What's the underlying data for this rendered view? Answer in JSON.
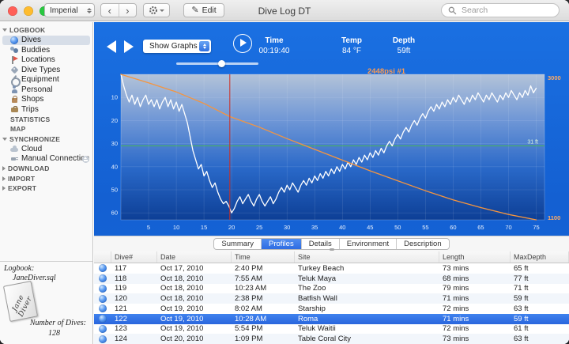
{
  "window": {
    "title": "Dive Log DT"
  },
  "toolbar": {
    "units_selector": "Imperial",
    "edit_label": "Edit",
    "search_placeholder": "Search"
  },
  "icons": {
    "back_chevron": "‹",
    "forward_chevron": "›",
    "pencil": "✎"
  },
  "sidebar": {
    "sections": [
      {
        "label": "LOGBOOK",
        "disclosure": "expanded",
        "items": [
          {
            "label": "Dives",
            "icon": "dive",
            "selected": true
          },
          {
            "label": "Buddies",
            "icon": "buddies"
          },
          {
            "label": "Locations",
            "icon": "location"
          },
          {
            "label": "Dive Types",
            "icon": "divetype"
          },
          {
            "label": "Equipment",
            "icon": "equipment"
          },
          {
            "label": "Personal",
            "icon": "personal"
          },
          {
            "label": "Shops",
            "icon": "shop"
          },
          {
            "label": "Trips",
            "icon": "trip"
          }
        ]
      },
      {
        "label": "STATISTICS",
        "disclosure": "none",
        "items": []
      },
      {
        "label": "MAP",
        "disclosure": "none",
        "items": []
      },
      {
        "label": "SYNCHRONIZE",
        "disclosure": "expanded",
        "items": [
          {
            "label": "Cloud",
            "icon": "cloud"
          },
          {
            "label": "Manual Connection",
            "icon": "connection",
            "trailing_icon": "eject"
          }
        ]
      },
      {
        "label": "DOWNLOAD",
        "disclosure": "collapsed",
        "items": []
      },
      {
        "label": "IMPORT",
        "disclosure": "collapsed",
        "items": []
      },
      {
        "label": "EXPORT",
        "disclosure": "collapsed",
        "items": []
      }
    ],
    "footer": {
      "logbook_label": "Logbook:",
      "logbook_name": "JaneDiver.sql",
      "book_text": "Jane Diver",
      "dive_count_label": "Number of Dives:",
      "dive_count": "128"
    }
  },
  "player": {
    "graph_mode": "Show Graphs",
    "time_label": "Time",
    "time_value": "00:19:40",
    "temp_label": "Temp",
    "temp_value": "84 °F",
    "depth_label": "Depth",
    "depth_value": "59ft",
    "pressure_readout": "2448psi #1",
    "slider_position": 0.55
  },
  "tabs": [
    "Summary",
    "Profiles",
    "Details",
    "Environment",
    "Description"
  ],
  "active_tab": "Profiles",
  "chart_data": {
    "type": "line",
    "x_unit": "min",
    "x_max": 76.5,
    "x_ticks": [
      5,
      10,
      15,
      20,
      25,
      30,
      35,
      40,
      45,
      50,
      55,
      60,
      65,
      70,
      75
    ],
    "depth_axis": {
      "unit": "ft",
      "max": 63,
      "ticks": [
        10,
        20,
        30,
        40,
        50,
        60
      ]
    },
    "pressure_axis": {
      "unit": "psi",
      "top": 3000,
      "bottom": 1100
    },
    "average_depth": {
      "value": 31,
      "label": "31 ft",
      "color": "#46b653"
    },
    "cursor": {
      "time_min": 19.67,
      "color": "#cf2e22"
    },
    "series": [
      {
        "name": "depth",
        "axis": "depth",
        "color": "#ffffff",
        "width": 1.3,
        "points": [
          [
            0,
            0
          ],
          [
            0.5,
            5
          ],
          [
            1,
            9
          ],
          [
            1.5,
            12
          ],
          [
            2,
            9
          ],
          [
            2.5,
            13
          ],
          [
            3,
            10
          ],
          [
            3.5,
            14
          ],
          [
            4,
            11
          ],
          [
            4.5,
            9
          ],
          [
            5,
            13
          ],
          [
            5.5,
            11
          ],
          [
            6,
            14
          ],
          [
            6.5,
            11
          ],
          [
            7,
            15
          ],
          [
            7.5,
            12
          ],
          [
            8,
            10
          ],
          [
            8.5,
            14
          ],
          [
            9,
            11
          ],
          [
            9.5,
            15
          ],
          [
            10,
            12
          ],
          [
            10.5,
            16
          ],
          [
            11,
            13
          ],
          [
            11.5,
            17
          ],
          [
            12,
            21
          ],
          [
            12.5,
            27
          ],
          [
            13,
            33
          ],
          [
            13.5,
            37
          ],
          [
            14,
            41
          ],
          [
            14.5,
            39
          ],
          [
            15,
            44
          ],
          [
            15.5,
            42
          ],
          [
            16,
            46
          ],
          [
            16.5,
            49
          ],
          [
            17,
            47
          ],
          [
            17.5,
            51
          ],
          [
            18,
            54
          ],
          [
            18.5,
            56
          ],
          [
            19,
            55
          ],
          [
            19.5,
            57
          ],
          [
            20,
            60
          ],
          [
            20.5,
            58
          ],
          [
            21,
            55
          ],
          [
            21.5,
            53
          ],
          [
            22,
            56
          ],
          [
            22.5,
            54
          ],
          [
            23,
            52
          ],
          [
            23.5,
            55
          ],
          [
            24,
            57
          ],
          [
            24.5,
            54
          ],
          [
            25,
            52
          ],
          [
            25.5,
            55
          ],
          [
            26,
            57
          ],
          [
            26.5,
            55
          ],
          [
            27,
            53
          ],
          [
            27.5,
            56
          ],
          [
            28,
            54
          ],
          [
            28.5,
            51
          ],
          [
            29,
            49
          ],
          [
            29.5,
            51
          ],
          [
            30,
            48
          ],
          [
            30.5,
            50
          ],
          [
            31,
            47
          ],
          [
            31.5,
            49
          ],
          [
            32,
            51
          ],
          [
            32.5,
            48
          ],
          [
            33,
            46
          ],
          [
            33.5,
            48
          ],
          [
            34,
            45
          ],
          [
            34.5,
            47
          ],
          [
            35,
            44
          ],
          [
            35.5,
            46
          ],
          [
            36,
            43
          ],
          [
            36.5,
            45
          ],
          [
            37,
            42
          ],
          [
            37.5,
            44
          ],
          [
            38,
            41
          ],
          [
            38.5,
            43
          ],
          [
            39,
            40
          ],
          [
            39.5,
            42
          ],
          [
            40,
            39
          ],
          [
            40.5,
            41
          ],
          [
            41,
            38
          ],
          [
            41.5,
            40
          ],
          [
            42,
            37
          ],
          [
            42.5,
            39
          ],
          [
            43,
            36
          ],
          [
            43.5,
            38
          ],
          [
            44,
            35
          ],
          [
            44.5,
            37
          ],
          [
            45,
            34
          ],
          [
            45.5,
            36
          ],
          [
            46,
            33
          ],
          [
            46.5,
            35
          ],
          [
            47,
            32
          ],
          [
            47.5,
            34
          ],
          [
            48,
            31
          ],
          [
            48.5,
            29
          ],
          [
            49,
            31
          ],
          [
            49.5,
            28
          ],
          [
            50,
            26
          ],
          [
            50.5,
            28
          ],
          [
            51,
            25
          ],
          [
            51.5,
            23
          ],
          [
            52,
            25
          ],
          [
            52.5,
            22
          ],
          [
            53,
            20
          ],
          [
            53.5,
            22
          ],
          [
            54,
            19
          ],
          [
            54.5,
            17
          ],
          [
            55,
            19
          ],
          [
            55.5,
            16
          ],
          [
            56,
            14
          ],
          [
            56.5,
            16
          ],
          [
            57,
            13
          ],
          [
            57.5,
            15
          ],
          [
            58,
            12
          ],
          [
            58.5,
            14
          ],
          [
            59,
            11
          ],
          [
            59.5,
            13
          ],
          [
            60,
            10
          ],
          [
            60.5,
            12
          ],
          [
            61,
            9
          ],
          [
            61.5,
            11
          ],
          [
            62,
            13
          ],
          [
            62.5,
            10
          ],
          [
            63,
            12
          ],
          [
            63.5,
            9
          ],
          [
            64,
            11
          ],
          [
            64.5,
            8
          ],
          [
            65,
            10
          ],
          [
            65.5,
            12
          ],
          [
            66,
            9
          ],
          [
            66.5,
            11
          ],
          [
            67,
            8
          ],
          [
            67.5,
            10
          ],
          [
            68,
            12
          ],
          [
            68.5,
            9
          ],
          [
            69,
            11
          ],
          [
            69.5,
            8
          ],
          [
            70,
            10
          ],
          [
            70.5,
            7
          ],
          [
            71,
            9
          ],
          [
            71.5,
            11
          ],
          [
            72,
            8
          ],
          [
            72.5,
            10
          ],
          [
            73,
            7
          ],
          [
            73.5,
            9
          ],
          [
            74,
            5
          ],
          [
            74.5,
            8
          ],
          [
            75,
            6
          ]
        ]
      },
      {
        "name": "tank_pressure",
        "axis": "pressure",
        "color": "#f5953f",
        "width": 1.3,
        "points": [
          [
            0,
            3000
          ],
          [
            5,
            2890
          ],
          [
            10,
            2770
          ],
          [
            15,
            2620
          ],
          [
            19.7,
            2448
          ],
          [
            25,
            2310
          ],
          [
            30,
            2160
          ],
          [
            35,
            2020
          ],
          [
            40,
            1880
          ],
          [
            45,
            1740
          ],
          [
            50,
            1610
          ],
          [
            55,
            1480
          ],
          [
            60,
            1360
          ],
          [
            65,
            1260
          ],
          [
            70,
            1170
          ],
          [
            75,
            1100
          ]
        ]
      }
    ]
  },
  "table": {
    "columns": [
      "Dive#",
      "Date",
      "Time",
      "Site",
      "Length",
      "MaxDepth"
    ],
    "selected_dive": "122",
    "rows": [
      {
        "dive": "117",
        "date": "Oct 17, 2010",
        "time": "2:40 PM",
        "site": "Turkey Beach",
        "length": "73 mins",
        "max_depth": "65 ft"
      },
      {
        "dive": "118",
        "date": "Oct 18, 2010",
        "time": "7:55 AM",
        "site": "Teluk Maya",
        "length": "68 mins",
        "max_depth": "77 ft"
      },
      {
        "dive": "119",
        "date": "Oct 18, 2010",
        "time": "10:23 AM",
        "site": "The Zoo",
        "length": "79 mins",
        "max_depth": "71 ft"
      },
      {
        "dive": "120",
        "date": "Oct 18, 2010",
        "time": "2:38 PM",
        "site": "Batfish Wall",
        "length": "71 mins",
        "max_depth": "59 ft"
      },
      {
        "dive": "121",
        "date": "Oct 19, 2010",
        "time": "8:02 AM",
        "site": "Starship",
        "length": "72 mins",
        "max_depth": "63 ft"
      },
      {
        "dive": "122",
        "date": "Oct 19, 2010",
        "time": "10:28 AM",
        "site": "Roma",
        "length": "71 mins",
        "max_depth": "59 ft",
        "selected": true
      },
      {
        "dive": "123",
        "date": "Oct 19, 2010",
        "time": "5:54 PM",
        "site": "Teluk Waitii",
        "length": "72 mins",
        "max_depth": "61 ft"
      },
      {
        "dive": "124",
        "date": "Oct 20, 2010",
        "time": "1:09 PM",
        "site": "Table Coral City",
        "length": "73 mins",
        "max_depth": "63 ft"
      }
    ]
  },
  "colors": {
    "main_background": "#1667db",
    "selection_blue": "#2e6ce2",
    "pressure_orange": "#f5953f",
    "average_green": "#46b653",
    "cursor_red": "#cf2e22",
    "sidebar_selected": "#d7dee8"
  }
}
